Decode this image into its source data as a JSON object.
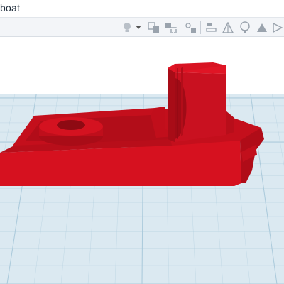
{
  "window": {
    "title": "boat"
  },
  "toolbar": {
    "buttons": [
      {
        "icon": "lightbulb-icon"
      },
      {
        "icon": "dropdown-arrow-icon"
      },
      {
        "icon": "group-icon"
      },
      {
        "icon": "ungroup-icon"
      },
      {
        "icon": "workplane-icon"
      },
      {
        "icon": "align-icon"
      },
      {
        "icon": "mirror-icon"
      },
      {
        "icon": "paint-icon"
      }
    ]
  },
  "scene": {
    "model_color": "#d0101e",
    "grid_color": "#a8c8da",
    "workplane_color": "#dbe9f1"
  }
}
